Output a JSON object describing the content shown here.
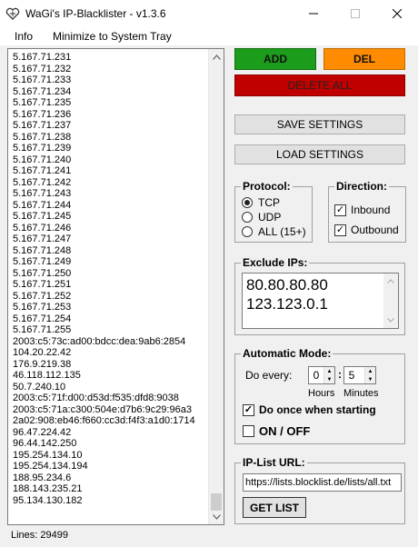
{
  "window": {
    "title": "WaGi's IP-Blacklister - v1.3.6",
    "controls": {
      "minimize": "—",
      "maximize": "☐",
      "close": "✕"
    }
  },
  "menu": {
    "items": [
      "Info",
      "Minimize to System Tray"
    ]
  },
  "ip_list": {
    "entries": [
      "5.167.71.231",
      "5.167.71.232",
      "5.167.71.233",
      "5.167.71.234",
      "5.167.71.235",
      "5.167.71.236",
      "5.167.71.237",
      "5.167.71.238",
      "5.167.71.239",
      "5.167.71.240",
      "5.167.71.241",
      "5.167.71.242",
      "5.167.71.243",
      "5.167.71.244",
      "5.167.71.245",
      "5.167.71.246",
      "5.167.71.247",
      "5.167.71.248",
      "5.167.71.249",
      "5.167.71.250",
      "5.167.71.251",
      "5.167.71.252",
      "5.167.71.253",
      "5.167.71.254",
      "5.167.71.255",
      "2003:c5:73c:ad00:bdcc:dea:9ab6:2854",
      "104.20.22.42",
      "176.9.219.38",
      "46.118.112.135",
      "50.7.240.10",
      "2003:c5:71f:d00:d53d:f535:dfd8:9038",
      "2003:c5:71a:c300:504e:d7b6:9c29:96a3",
      "2a02:908:eb46:f660:cc3d:f4f3:a1d0:1714",
      "96.47.224.42",
      "96.44.142.250",
      "195.254.134.10",
      "195.254.134.194",
      "188.95.234.6",
      "188.143.235.21",
      "95.134.130.182"
    ],
    "line_count": "Lines: 29499"
  },
  "buttons": {
    "add": "ADD",
    "del": "DEL",
    "delete_all": "DELETE ALL",
    "save_settings": "SAVE SETTINGS",
    "load_settings": "LOAD SETTINGS",
    "get_list": "GET LIST"
  },
  "protocol": {
    "title": "Protocol:",
    "options": [
      "TCP",
      "UDP",
      "ALL (15+)"
    ],
    "selected": "TCP"
  },
  "direction": {
    "title": "Direction:",
    "inbound": {
      "label": "Inbound",
      "checked": true
    },
    "outbound": {
      "label": "Outbound",
      "checked": true
    }
  },
  "exclude": {
    "title": "Exclude IPs:",
    "ips": [
      "80.80.80.80",
      "123.123.0.1"
    ]
  },
  "automatic": {
    "title": "Automatic Mode:",
    "do_every_label": "Do every:",
    "hours_value": "0",
    "minutes_value": "5",
    "separator": ":",
    "hours_label": "Hours",
    "minutes_label": "Minutes",
    "do_once": {
      "label": "Do once when starting",
      "checked": true
    },
    "on_off": {
      "label": "ON / OFF",
      "checked": false
    }
  },
  "iplist_url": {
    "title": "IP-List URL:",
    "value": "https://lists.blocklist.de/lists/all.txt"
  },
  "colors": {
    "add": "#1b9c1b",
    "del": "#ff8c00",
    "delete_all": "#c00000"
  }
}
